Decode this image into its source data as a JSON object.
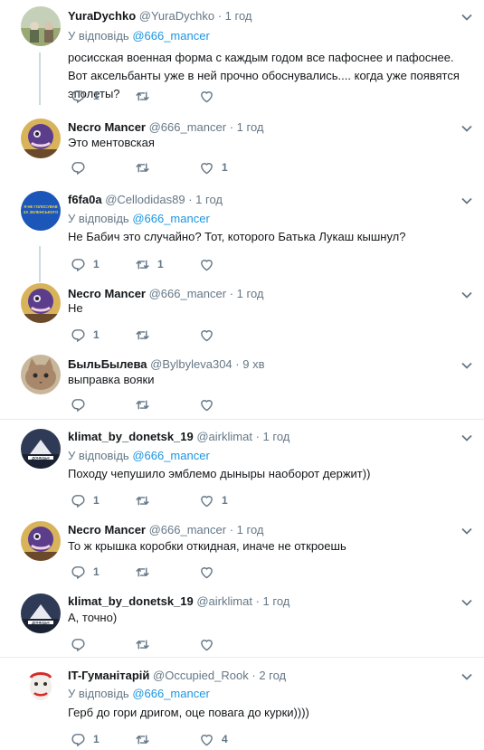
{
  "tweets": [
    {
      "name": "YuraDychko",
      "handle": "@YuraDychko",
      "dot": "·",
      "time": "1 год",
      "reply_prefix": "У відповідь",
      "reply_to": "@666_mancer",
      "text": "росисская военная форма с каждым годом все пафоснее и пафоснее. Вот аксельбанты уже в ней прочно обоснувались.... когда уже появятся эполеты?",
      "reply_count": "1",
      "retweet_count": "",
      "like_count": "",
      "avatar": "field-photo"
    },
    {
      "name": "Necro Mancer",
      "handle": "@666_mancer",
      "dot": "·",
      "time": "1 год",
      "text": "Это ментовская",
      "reply_count": "",
      "retweet_count": "",
      "like_count": "1",
      "avatar": "creature"
    },
    {
      "name": "f6fa0a",
      "handle": "@Cellodidas89",
      "dot": "·",
      "time": "1 год",
      "reply_prefix": "У відповідь",
      "reply_to": "@666_mancer",
      "text": "Не Бабич это случайно? Тот, которого Батька Лукаш кышнул?",
      "reply_count": "1",
      "retweet_count": "1",
      "like_count": "",
      "avatar": "blue-flag"
    },
    {
      "name": "Necro Mancer",
      "handle": "@666_mancer",
      "dot": "·",
      "time": "1 год",
      "text": "Не",
      "reply_count": "1",
      "retweet_count": "",
      "like_count": "",
      "avatar": "creature"
    },
    {
      "name": "БыльБылева",
      "handle": "@Bylbyleva304",
      "dot": "·",
      "time": "9 хв",
      "text": "выправка вояки",
      "reply_count": "",
      "retweet_count": "",
      "like_count": "",
      "avatar": "cat"
    },
    {
      "name": "klimat_by_donetsk_19",
      "handle": "@airklimat",
      "dot": "·",
      "time": "1 год",
      "reply_prefix": "У відповідь",
      "reply_to": "@666_mancer",
      "text": "Походу чепушило эмблемо дыныры наоборот держит))",
      "reply_count": "1",
      "retweet_count": "",
      "like_count": "1",
      "avatar": "city"
    },
    {
      "name": "Necro Mancer",
      "handle": "@666_mancer",
      "dot": "·",
      "time": "1 год",
      "text": "То ж крышка коробки откидная, иначе не откроешь",
      "reply_count": "1",
      "retweet_count": "",
      "like_count": "",
      "avatar": "creature"
    },
    {
      "name": "klimat_by_donetsk_19",
      "handle": "@airklimat",
      "dot": "·",
      "time": "1 год",
      "text": "А, точно)",
      "reply_count": "",
      "retweet_count": "",
      "like_count": "",
      "avatar": "city"
    },
    {
      "name": "IT-Гуманітарій",
      "handle": "@Occupied_Rook",
      "dot": "·",
      "time": "2 год",
      "reply_prefix": "У відповідь",
      "reply_to": "@666_mancer",
      "text": "Герб до гори дригом, оце повага до курки))))",
      "reply_count": "1",
      "retweet_count": "",
      "like_count": "4",
      "avatar": "clown"
    }
  ],
  "avatar_text": {
    "blue_flag": "Я НЕ ГОЛОСУВАВ ЗА ЗЕЛЕНСЬКОГО"
  },
  "colors": {
    "link": "#1b95e0",
    "muted": "#657786",
    "line": "#cfd9de",
    "divider": "#e6ecf0"
  }
}
